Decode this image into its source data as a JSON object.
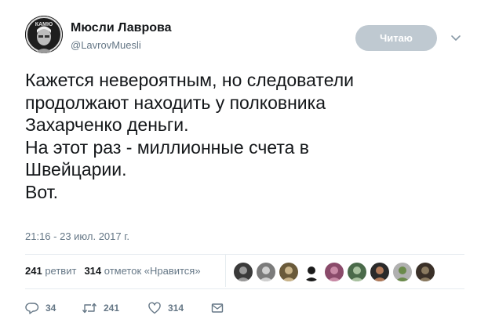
{
  "author": {
    "display_name": "Мюсли Лаврова",
    "handle": "@LavrovMuesli",
    "avatar_text": "КАМЮ",
    "follow_label": "Читаю"
  },
  "tweet": {
    "lines": [
      "Кажется невероятным, но следователи",
      "продолжают находить у полковника",
      "Захарченко деньги.",
      "На этот раз - миллионные счета в",
      "Швейцарии.",
      "Вот."
    ],
    "timestamp": "21:16 - 23 июл. 2017 г."
  },
  "stats": {
    "retweet_count": "241",
    "retweet_label": "ретвит",
    "like_count": "314",
    "like_label": "отметок «Нравится»"
  },
  "likers": [
    {
      "color": "#3a3a3a",
      "accent": "#9a9a9a"
    },
    {
      "color": "#7b7b7b",
      "accent": "#d0d0d0"
    },
    {
      "color": "#6a5a3a",
      "accent": "#c9b48a"
    },
    {
      "color": "#ffffff",
      "accent": "#1a1a1a"
    },
    {
      "color": "#8a4a6a",
      "accent": "#c98aa6"
    },
    {
      "color": "#4a6a4a",
      "accent": "#a9c2a0"
    },
    {
      "color": "#2a2a2a",
      "accent": "#b07a5a"
    },
    {
      "color": "#b0b0b0",
      "accent": "#6a8a4a"
    },
    {
      "color": "#3a3028",
      "accent": "#8a7a60"
    }
  ],
  "actions": {
    "reply_count": "34",
    "retweet_count": "241",
    "like_count": "314"
  },
  "colors": {
    "text": "#14171a",
    "secondary": "#657786",
    "follow_button": "#bfc9d1",
    "divider": "#e6ecf0"
  }
}
